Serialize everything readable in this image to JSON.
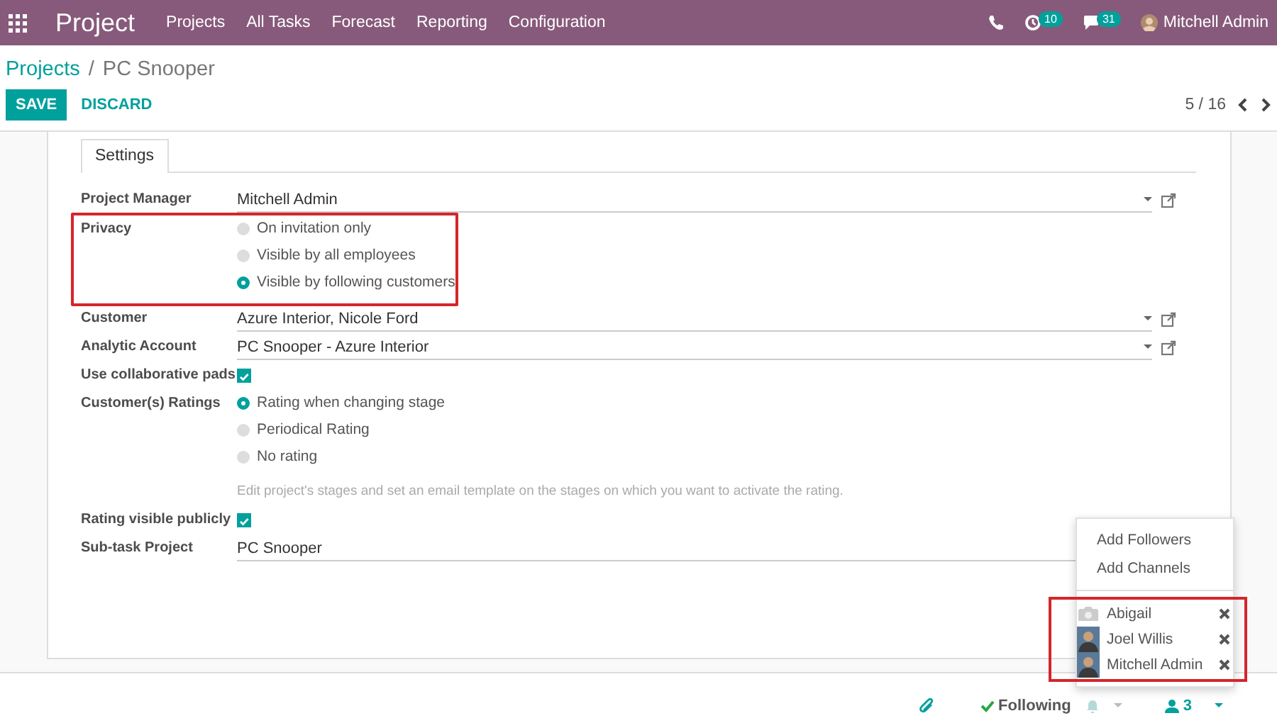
{
  "navbar": {
    "app_title": "Project",
    "menus": [
      "Projects",
      "All Tasks",
      "Forecast",
      "Reporting",
      "Configuration"
    ],
    "activity_count": "10",
    "message_count": "31",
    "user": "Mitchell Admin"
  },
  "breadcrumb": [
    {
      "label": "Projects",
      "kind": "link"
    },
    {
      "label": "/",
      "kind": "separator"
    },
    {
      "label": "PC Snooper",
      "kind": "current"
    }
  ],
  "buttons": [
    {
      "label": "SAVE",
      "kind": "primary"
    },
    {
      "label": "DISCARD",
      "kind": "link"
    }
  ],
  "pager": {
    "text": "5 / 16"
  },
  "tabs": [
    {
      "label": "Settings",
      "selected": true
    }
  ],
  "fields": [
    {
      "label": "Project Manager",
      "kind": "many2one",
      "value": "Mitchell Admin"
    },
    {
      "label": "Privacy",
      "kind": "radio",
      "highlighted": true,
      "options": [
        {
          "label": "On invitation only",
          "selected": false
        },
        {
          "label": "Visible by all employees",
          "selected": false
        },
        {
          "label": "Visible by following customers",
          "selected": true
        }
      ]
    },
    {
      "label": "Customer",
      "kind": "many2one",
      "value": "Azure Interior, Nicole Ford"
    },
    {
      "label": "Analytic Account",
      "kind": "many2one",
      "value": "PC Snooper - Azure Interior"
    },
    {
      "label": "Use collaborative pads",
      "kind": "checkbox",
      "checked": true
    },
    {
      "label": "Customer(s) Ratings",
      "kind": "radio",
      "options": [
        {
          "label": "Rating when changing stage",
          "selected": true
        },
        {
          "label": "Periodical Rating",
          "selected": false
        },
        {
          "label": "No rating",
          "selected": false
        }
      ],
      "help": "Edit project's stages and set an email template on the stages on which you want to activate the rating."
    },
    {
      "label": "Rating visible publicly",
      "kind": "checkbox",
      "checked": true
    },
    {
      "label": "Sub-task Project",
      "kind": "char",
      "value": "PC Snooper"
    }
  ],
  "chatter": {
    "following_label": "Following",
    "follower_count": "3"
  },
  "followers_menu": {
    "actions": [
      "Add Followers",
      "Add Channels"
    ],
    "highlighted": true,
    "followers": [
      {
        "name": "Abigail",
        "kind": "placeholder"
      },
      {
        "name": "Joel Willis",
        "kind": "photo"
      },
      {
        "name": "Mitchell Admin",
        "kind": "photo"
      }
    ]
  }
}
